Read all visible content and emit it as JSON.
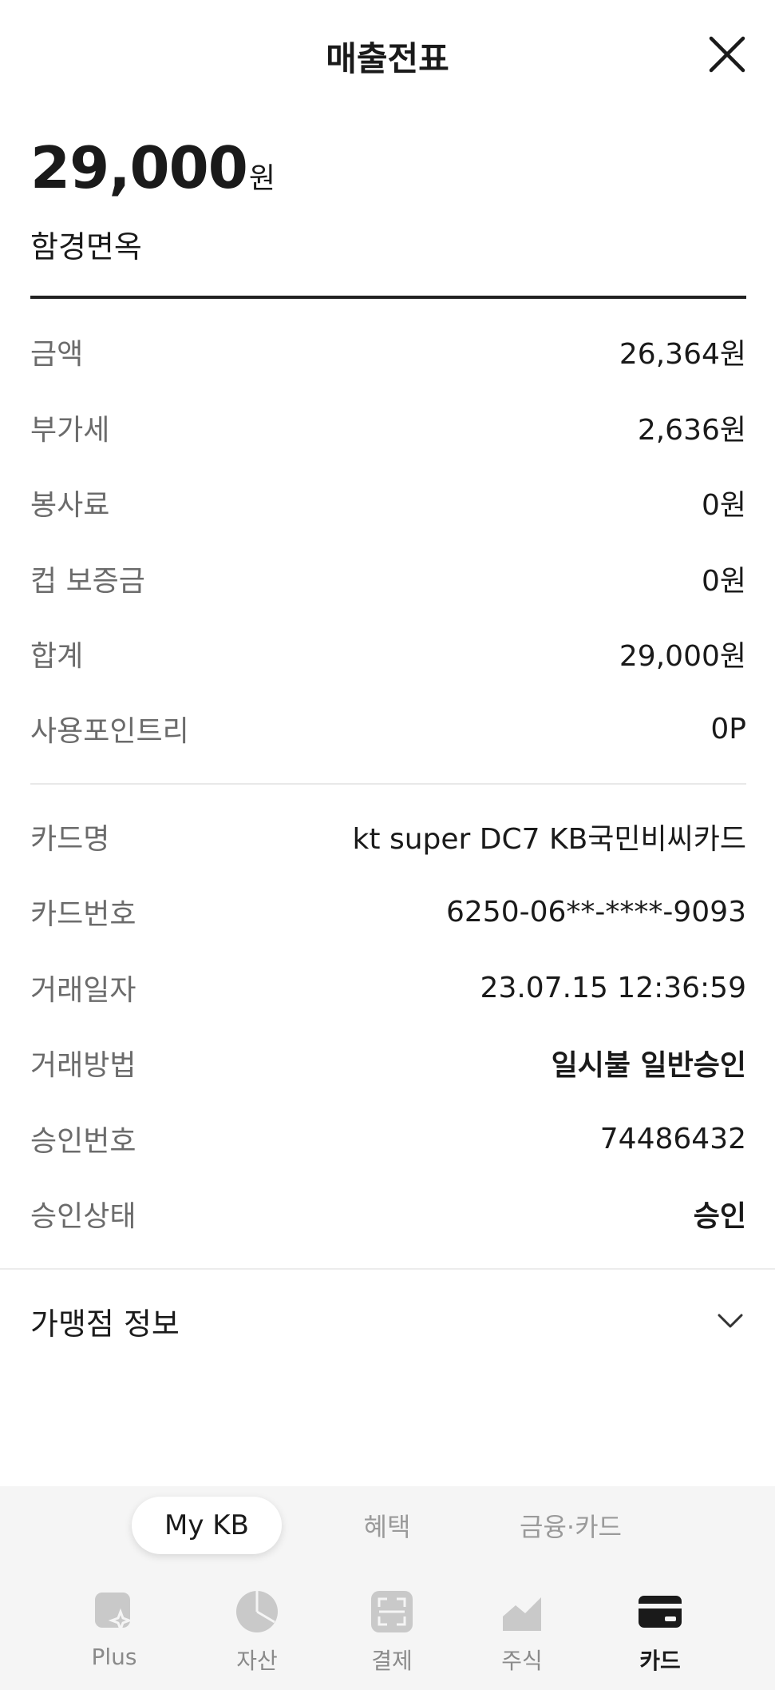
{
  "header": {
    "title": "매출전표"
  },
  "summary": {
    "amount": "29,000",
    "unit": "원",
    "merchant": "함경면옥"
  },
  "payment_rows": [
    {
      "label": "금액",
      "value": "26,364원"
    },
    {
      "label": "부가세",
      "value": "2,636원"
    },
    {
      "label": "봉사료",
      "value": "0원"
    },
    {
      "label": "컵 보증금",
      "value": "0원"
    },
    {
      "label": "합계",
      "value": "29,000원"
    },
    {
      "label": "사용포인트리",
      "value": "0P"
    }
  ],
  "card_rows": [
    {
      "label": "카드명",
      "value": "kt super DC7 KB국민비씨카드"
    },
    {
      "label": "카드번호",
      "value": "6250-06**-****-9093"
    },
    {
      "label": "거래일자",
      "value": "23.07.15 12:36:59"
    },
    {
      "label": "거래방법",
      "value": "일시불 일반승인"
    },
    {
      "label": "승인번호",
      "value": "74486432"
    },
    {
      "label": "승인상태",
      "value": "승인"
    }
  ],
  "merchant_info": {
    "label": "가맹점 정보"
  },
  "segment_tabs": [
    {
      "label": "My KB",
      "selected": true
    },
    {
      "label": "혜택"
    },
    {
      "label": "금융·카드"
    }
  ],
  "bottom_nav": [
    {
      "label": "Plus",
      "icon": "plus-sparkle-icon"
    },
    {
      "label": "자산",
      "icon": "pie-chart-icon"
    },
    {
      "label": "결제",
      "icon": "scan-icon"
    },
    {
      "label": "주식",
      "icon": "stock-chart-icon"
    },
    {
      "label": "카드",
      "icon": "card-icon",
      "active": true
    }
  ],
  "colors": {
    "label_gray": "#6b6b6b",
    "text": "#1a1a1a",
    "nav_inactive": "#c4c4c4"
  }
}
